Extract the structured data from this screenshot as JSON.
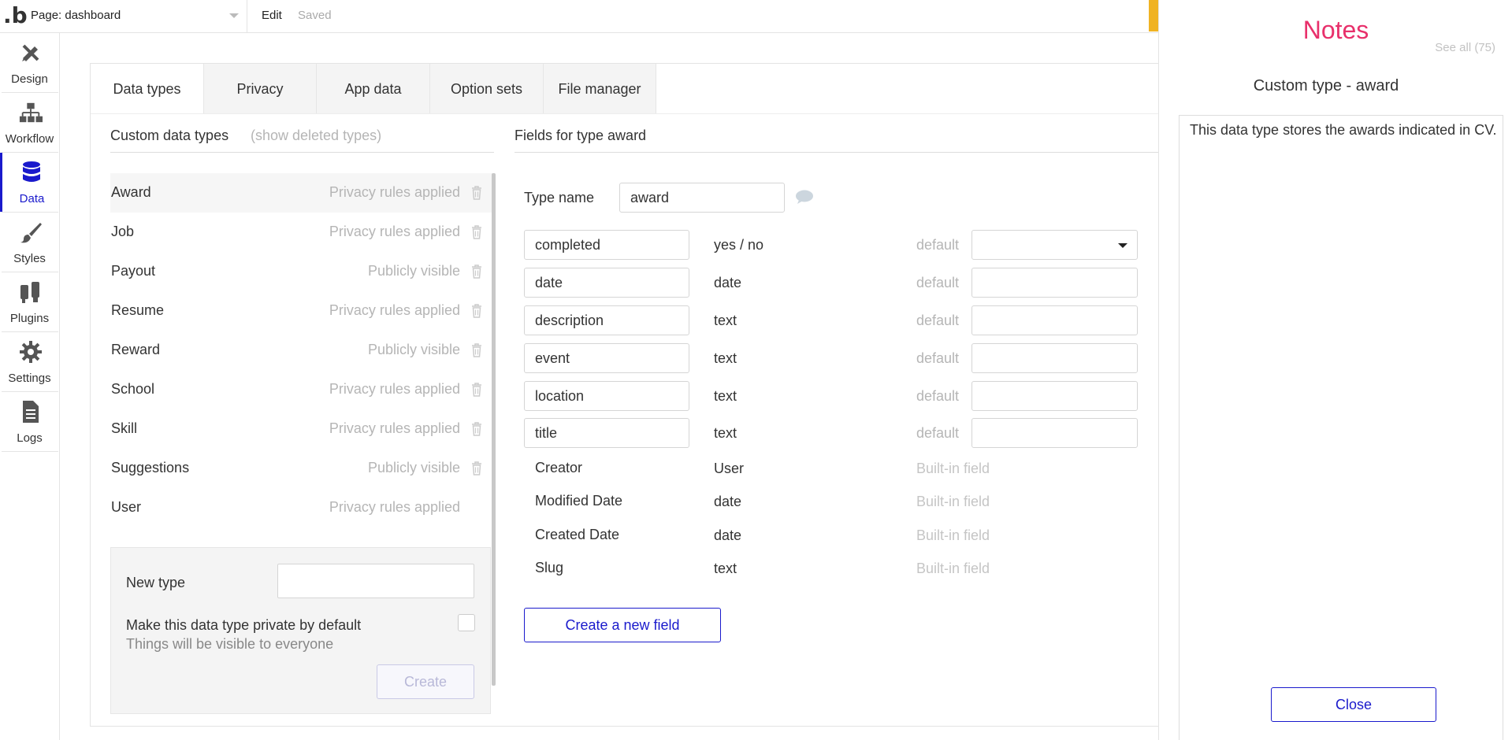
{
  "topbar": {
    "logo": ".b",
    "page_select": "Page: dashboard",
    "edit": "Edit",
    "saved": "Saved"
  },
  "sidebar": {
    "items": [
      {
        "label": "Design",
        "icon": "design-icon"
      },
      {
        "label": "Workflow",
        "icon": "workflow-icon"
      },
      {
        "label": "Data",
        "icon": "database-icon",
        "active": true
      },
      {
        "label": "Styles",
        "icon": "brush-icon"
      },
      {
        "label": "Plugins",
        "icon": "plug-icon"
      },
      {
        "label": "Settings",
        "icon": "gear-icon"
      },
      {
        "label": "Logs",
        "icon": "document-icon"
      }
    ]
  },
  "tabs": [
    "Data types",
    "Privacy",
    "App data",
    "Option sets",
    "File manager"
  ],
  "data_types": {
    "title": "Custom data types",
    "show_deleted": "(show deleted types)",
    "items": [
      {
        "name": "Award",
        "privacy": "Privacy rules applied"
      },
      {
        "name": "Job",
        "privacy": "Privacy rules applied"
      },
      {
        "name": "Payout",
        "privacy": "Publicly visible"
      },
      {
        "name": "Resume",
        "privacy": "Privacy rules applied"
      },
      {
        "name": "Reward",
        "privacy": "Publicly visible"
      },
      {
        "name": "School",
        "privacy": "Privacy rules applied"
      },
      {
        "name": "Skill",
        "privacy": "Privacy rules applied"
      },
      {
        "name": "Suggestions",
        "privacy": "Publicly visible"
      },
      {
        "name": "User",
        "privacy": "Privacy rules applied"
      }
    ]
  },
  "new_type": {
    "label": "New type",
    "value": "",
    "private_label": "Make this data type private by default",
    "private_sub": "Things will be visible to everyone",
    "create": "Create"
  },
  "fields": {
    "title": "Fields for type award",
    "type_name_label": "Type name",
    "type_name_value": "award",
    "custom": [
      {
        "name": "completed",
        "type": "yes / no",
        "default_label": "default"
      },
      {
        "name": "date",
        "type": "date",
        "default_label": "default"
      },
      {
        "name": "description",
        "type": "text",
        "default_label": "default"
      },
      {
        "name": "event",
        "type": "text",
        "default_label": "default"
      },
      {
        "name": "location",
        "type": "text",
        "default_label": "default"
      },
      {
        "name": "title",
        "type": "text",
        "default_label": "default"
      }
    ],
    "builtin": [
      {
        "name": "Creator",
        "type": "User",
        "note": "Built-in field"
      },
      {
        "name": "Modified Date",
        "type": "date",
        "note": "Built-in field"
      },
      {
        "name": "Created Date",
        "type": "date",
        "note": "Built-in field"
      },
      {
        "name": "Slug",
        "type": "text",
        "note": "Built-in field"
      }
    ],
    "create_button": "Create a new field"
  },
  "notes": {
    "title": "Notes",
    "see_all": "See all (75)",
    "subtitle": "Custom type - award",
    "text": "This data type stores the awards indicated in CV.",
    "close": "Close"
  },
  "colors": {
    "accent": "#1a1acc",
    "notes_title": "#e8306b",
    "warning_tab": "#f0b323"
  }
}
